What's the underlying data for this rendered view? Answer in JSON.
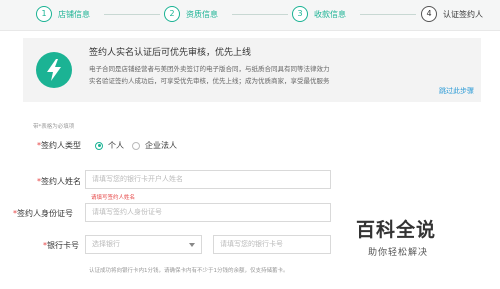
{
  "steps": [
    {
      "num": "1",
      "label": "店铺信息"
    },
    {
      "num": "2",
      "label": "资质信息"
    },
    {
      "num": "3",
      "label": "收款信息"
    },
    {
      "num": "4",
      "label": "认证签约人"
    }
  ],
  "notice": {
    "icon": "lightning-icon",
    "title": "签约人实名认证后可优先审核，优先上线",
    "desc_line1": "电子合同是店铺经营者与美团外卖签订的电子版合同，与纸质合同具有同等法律效力",
    "desc_line2": "实名验证签约人成功后，可享受优先审核，优先上线；成为优质商家，享受最优服务",
    "skip": "跳过此步骤"
  },
  "form": {
    "required_hint": "带*表格为必填项",
    "signer_type": {
      "label": "签约人类型",
      "options": [
        {
          "label": "个人",
          "selected": true
        },
        {
          "label": "企业法人",
          "selected": false
        }
      ]
    },
    "name": {
      "label": "签约人姓名",
      "placeholder": "请填写您的银行卡开户人姓名",
      "error": "请填写签约人姓名"
    },
    "id_number": {
      "label": "签约人身份证号",
      "placeholder": "请填写签约人身份证号"
    },
    "bank": {
      "label": "银行卡号",
      "select_placeholder": "选择银行",
      "card_placeholder": "请填写您的银行卡号",
      "footnote": "认证成功将向银行卡内1分钱，请确保卡内有不少于1分钱的余额，仅支持储蓄卡。"
    }
  },
  "watermark": {
    "brand": "百科全说",
    "slogan": "助你轻松解决"
  },
  "colors": {
    "accent": "#1bb394",
    "error": "#e64545",
    "link": "#2a9ad6"
  }
}
